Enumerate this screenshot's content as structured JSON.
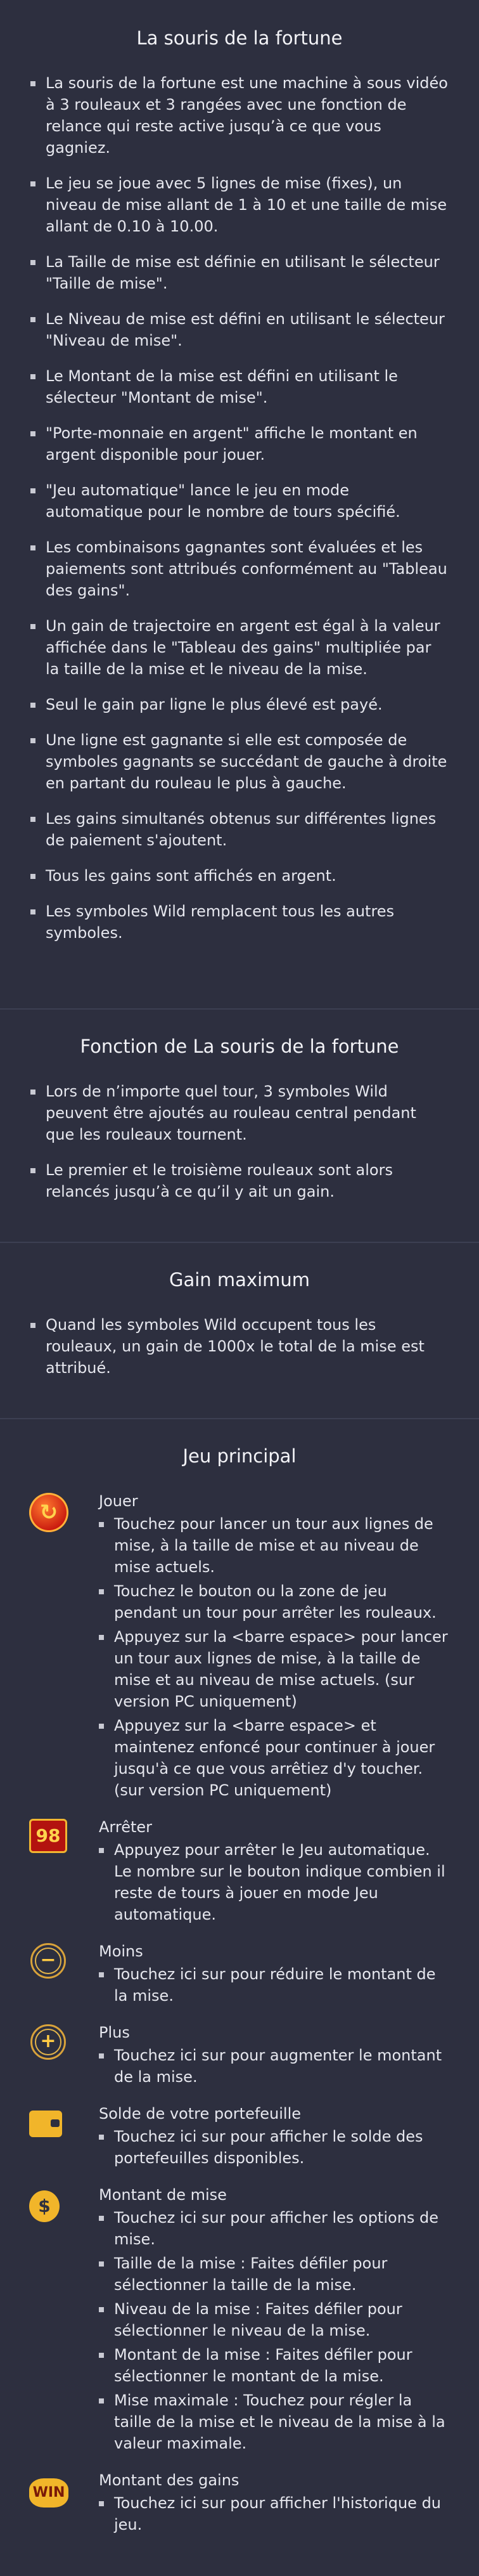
{
  "sections": {
    "intro": {
      "title": "La souris de la fortune",
      "items": [
        "La souris de la fortune est une machine à sous vidéo à 3 rouleaux et 3 rangées avec une fonction de relance qui reste active jusqu’à ce que vous gagniez.",
        "Le jeu se joue avec 5 lignes de mise (fixes), un niveau de mise allant de 1 à 10 et une taille de mise allant de 0.10 à 10.00.",
        "La Taille de mise est définie en utilisant le sélecteur \"Taille de mise\".",
        "Le Niveau de mise est défini en utilisant le sélecteur \"Niveau de mise\".",
        "Le Montant de la mise est défini en utilisant le sélecteur \"Montant de mise\".",
        "\"Porte-monnaie en argent\" affiche le montant en argent disponible pour jouer.",
        "\"Jeu automatique\" lance le jeu en mode automatique pour le nombre de tours spécifié.",
        "Les combinaisons gagnantes sont évaluées et les paiements sont attribués conformément au \"Tableau des gains\".",
        "Un gain de trajectoire en argent est égal à la valeur affichée dans le \"Tableau des gains\" multipliée par la taille de la mise et le niveau de la mise.",
        "Seul le gain par ligne le plus élevé est payé.",
        "Une ligne est gagnante si elle est composée de symboles gagnants se succédant de gauche à droite en partant du rouleau le plus à gauche.",
        "Les gains simultanés obtenus sur différentes lignes de paiement s'ajoutent.",
        "Tous les gains sont affichés en argent.",
        "Les symboles Wild remplacent tous les autres symboles."
      ]
    },
    "feature": {
      "title": "Fonction de La souris de la fortune",
      "items": [
        "Lors de n’importe quel tour, 3 symboles Wild peuvent être ajoutés au rouleau central pendant que les rouleaux tournent.",
        "Le premier et le troisième rouleaux sont alors relancés jusqu’à ce qu’il y ait un gain."
      ]
    },
    "maxwin": {
      "title": "Gain maximum",
      "items": [
        "Quand les symboles Wild occupent tous les rouleaux, un gain de 1000x le total de la mise est attribué."
      ]
    },
    "main": {
      "title": "Jeu principal",
      "controls": [
        {
          "icon": "spin-icon",
          "glyph": "↻",
          "name": "Jouer",
          "items": [
            "Touchez pour lancer un tour aux lignes de mise, à la taille de mise et au niveau de mise actuels.",
            "Touchez le bouton ou la zone de jeu pendant un tour pour arrêter les rouleaux.",
            "Appuyez sur la <barre espace> pour lancer un tour aux lignes de mise, à la taille de mise et au niveau de mise actuels. (sur version PC uniquement)",
            "Appuyez sur la <barre espace> et maintenez enfoncé pour continuer à jouer jusqu'à ce que vous arrêtiez d'y toucher. (sur version PC uniquement)"
          ]
        },
        {
          "icon": "autoplay-counter-icon",
          "glyph": "98",
          "name": "Arrêter",
          "items": [
            "Appuyez pour arrêter le Jeu automatique. Le nombre sur le bouton indique combien il reste de tours à jouer en mode Jeu automatique."
          ]
        },
        {
          "icon": "minus-icon",
          "glyph": "−",
          "name": "Moins",
          "items": [
            "Touchez ici sur pour réduire le montant de la mise."
          ]
        },
        {
          "icon": "plus-icon",
          "glyph": "+",
          "name": "Plus",
          "items": [
            "Touchez ici sur pour augmenter le montant de la mise."
          ]
        },
        {
          "icon": "wallet-icon",
          "glyph": "",
          "name": "Solde de votre portefeuille",
          "items": [
            "Touchez ici sur pour afficher le solde des portefeuilles disponibles."
          ]
        },
        {
          "icon": "coins-icon",
          "glyph": "$",
          "name": "Montant de mise",
          "items": [
            "Touchez ici sur pour afficher les options de mise.",
            "Taille de la mise : Faites défiler pour sélectionner la taille de la mise.",
            "Niveau de la mise : Faites défiler pour sélectionner le niveau de la mise.",
            "Montant de la mise : Faites défiler pour sélectionner le montant de la mise.",
            "Mise maximale : Touchez pour régler la taille de la mise et le niveau de la mise à la valeur maximale."
          ]
        },
        {
          "icon": "win-icon",
          "glyph": "WIN",
          "name": "Montant des gains",
          "items": [
            "Touchez ici sur pour afficher l'historique du jeu."
          ]
        }
      ]
    }
  }
}
